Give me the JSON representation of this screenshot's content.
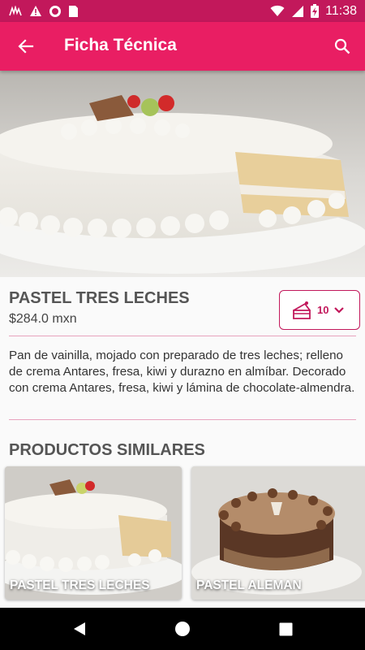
{
  "status_bar": {
    "time": "11:38",
    "icons": [
      "app-logo-icon",
      "warning-icon",
      "circle-icon",
      "sd-card-icon",
      "wifi-icon",
      "signal-icon",
      "battery-charging-icon"
    ]
  },
  "app_bar": {
    "title": "Ficha Técnica",
    "back_icon": "arrow-back-icon",
    "search_icon": "search-icon"
  },
  "product": {
    "name": "PASTEL TRES LECHES",
    "price": "$284.0 mxn",
    "quantity": "10",
    "description": "Pan de vainilla, mojado con preparado de tres leches; relleno de crema Antares, fresa, kiwi y durazno en almíbar. Decorado con crema Antares, fresa, kiwi y lámina de chocolate-almendra."
  },
  "similar": {
    "title": "PRODUCTOS SIMILARES",
    "items": [
      {
        "label": "PASTEL TRES LECHES"
      },
      {
        "label": "PASTEL ALEMAN"
      }
    ]
  },
  "colors": {
    "primary": "#e91e63",
    "primary_dark": "#c2185b",
    "accent_border": "#c2185b"
  }
}
